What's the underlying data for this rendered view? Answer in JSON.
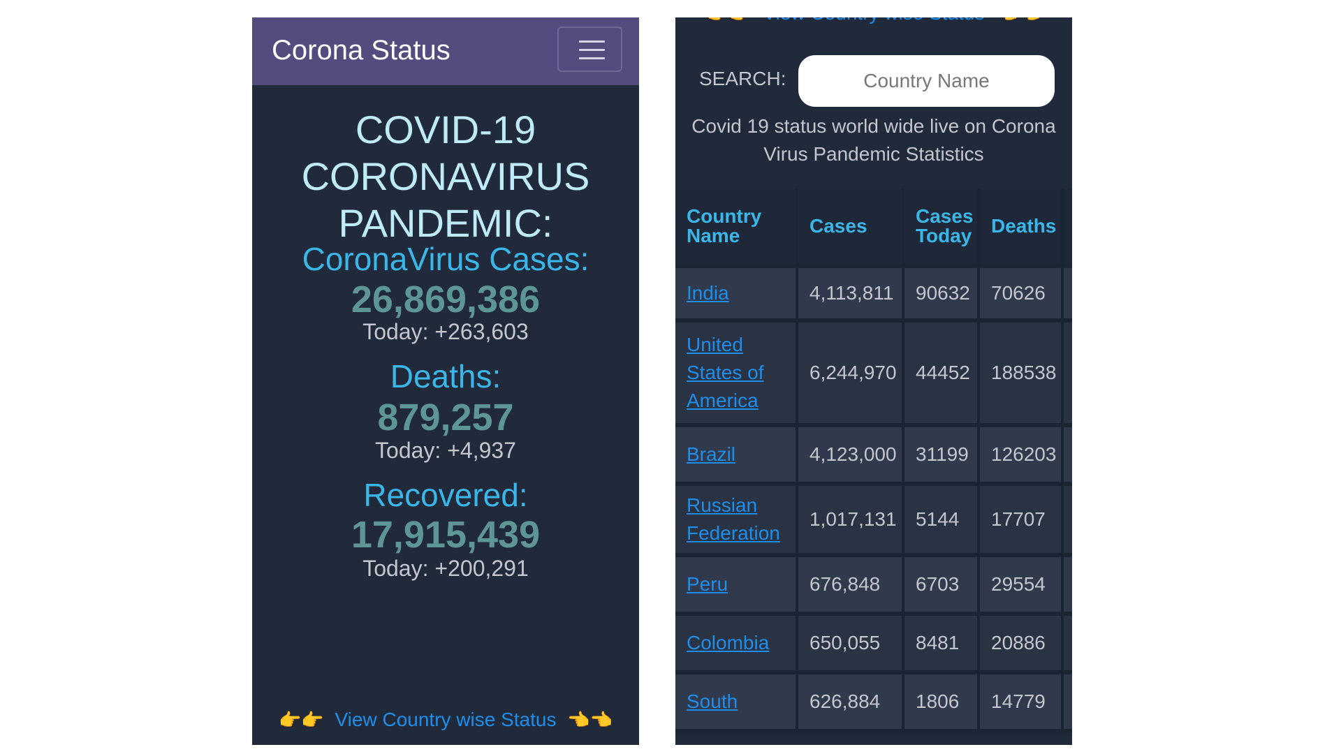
{
  "left": {
    "navbar": {
      "brand": "Corona Status"
    },
    "title": "COVID-19 CORONAVIRUS PANDEMIC:",
    "cases": {
      "label": "CoronaVirus Cases:",
      "value": "26,869,386",
      "today": "Today: +263,603"
    },
    "deaths": {
      "label": "Deaths:",
      "value": "879,257",
      "today": "Today: +4,937"
    },
    "recovered": {
      "label": "Recovered:",
      "value": "17,915,439",
      "today": "Today: +200,291"
    },
    "view_link": "View Country wise Status",
    "hand_right": "👉",
    "hand_left": "👈"
  },
  "right": {
    "top_partial": "View Country wise Status",
    "search": {
      "label": "SEARCH:",
      "placeholder": "Country Name"
    },
    "description": "Covid 19 status world wide live on Corona Virus Pandemic Statistics",
    "table": {
      "headers": [
        "Country Name",
        "Cases",
        "Cases Today",
        "Deaths"
      ],
      "rows": [
        {
          "country": "India",
          "cases": "4,113,811",
          "today": "90632",
          "deaths": "70626"
        },
        {
          "country": "United States of America",
          "cases": "6,244,970",
          "today": "44452",
          "deaths": "188538"
        },
        {
          "country": "Brazil",
          "cases": "4,123,000",
          "today": "31199",
          "deaths": "126203"
        },
        {
          "country": "Russian Federation",
          "cases": "1,017,131",
          "today": "5144",
          "deaths": "17707"
        },
        {
          "country": "Peru",
          "cases": "676,848",
          "today": "6703",
          "deaths": "29554"
        },
        {
          "country": "Colombia",
          "cases": "650,055",
          "today": "8481",
          "deaths": "20886"
        },
        {
          "country": "South",
          "cases": "626,884",
          "today": "1806",
          "deaths": "14779"
        }
      ]
    }
  },
  "colors": {
    "navbar": "#524d7e",
    "background": "#212a3b",
    "accent_blue": "#3ab6e8",
    "link_blue": "#1e8eea",
    "stat_value": "#5e9595",
    "hand": "#f2b21a"
  }
}
